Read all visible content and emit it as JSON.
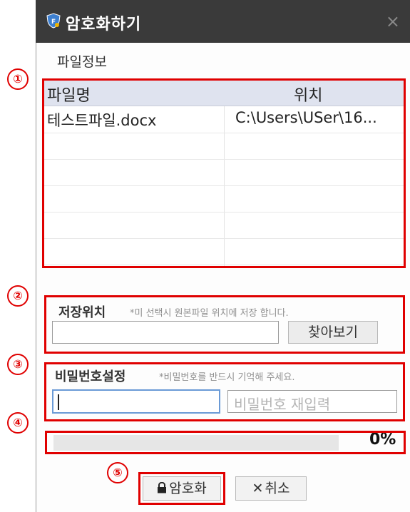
{
  "window": {
    "title": "암호화하기",
    "close_glyph": "×"
  },
  "file_info": {
    "section_label": "파일정보",
    "columns": [
      "파일명",
      "위치"
    ],
    "rows": [
      {
        "name": "테스트파일.docx",
        "location": "C:\\Users\\USer\\16..."
      }
    ]
  },
  "save_location": {
    "label": "저장위치",
    "hint": "*미 선택시 원본파일 위치에 저장 합니다.",
    "path_value": "",
    "browse_label": "찾아보기"
  },
  "password": {
    "label": "비밀번호설정",
    "hint": "*비밀번호를 반드시 기억해 주세요.",
    "password_value": "",
    "confirm_placeholder": "비밀번호 재입력"
  },
  "progress": {
    "percent": 0,
    "text": "0%"
  },
  "actions": {
    "encrypt_label": "암호화",
    "cancel_label": "취소",
    "cancel_glyph": "✕"
  },
  "annotations": [
    "①",
    "②",
    "③",
    "④",
    "⑤"
  ],
  "colors": {
    "titlebar": "#3a3a3a",
    "annotation_red": "#e00000",
    "table_header": "#dfe3ef",
    "focus_border": "#6a9ad6"
  }
}
